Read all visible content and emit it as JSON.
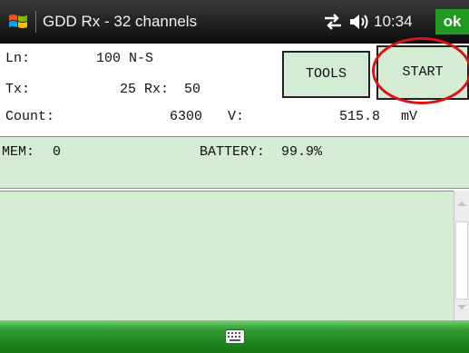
{
  "titlebar": {
    "app_title": "GDD Rx - 32 channels",
    "clock": "10:34",
    "ok_label": "ok",
    "icons": [
      "windows-start-icon",
      "connectivity-icon",
      "volume-icon"
    ]
  },
  "info": {
    "ln_label": "Ln:",
    "ln_value": "100 N-S",
    "tx_label": "Tx:",
    "tx_value": "25",
    "rx_label": "Rx:",
    "rx_value": "50",
    "count_label": "Count:",
    "count_value": "6300",
    "v_label": "V:",
    "v_value": "515.8",
    "v_unit": "mV"
  },
  "buttons": {
    "tools": "TOOLS",
    "start": "START"
  },
  "status": {
    "mem_label": "MEM:",
    "mem_value": "0",
    "battery_label": "BATTERY:",
    "battery_value": "99.9%"
  },
  "bottombar": {
    "icon": "keyboard-icon"
  },
  "colors": {
    "panel_green": "#d4ebd4",
    "ok_green": "#1f9a1f",
    "annotation_red": "#d81515"
  }
}
